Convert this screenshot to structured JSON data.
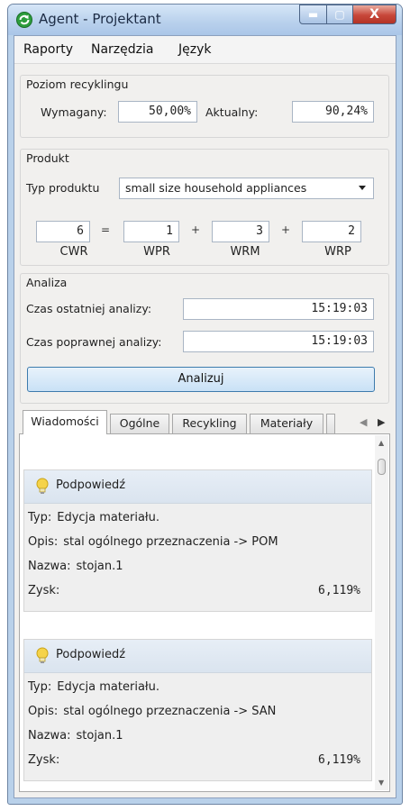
{
  "window": {
    "title": "Agent - Projektant",
    "min_glyph": "▬",
    "max_glyph": "▢",
    "close_glyph": "X"
  },
  "menu": {
    "items": [
      "Raporty",
      "Narzędzia",
      "Język"
    ]
  },
  "recycling": {
    "group_label": "Poziom recyklingu",
    "required_label": "Wymagany:",
    "required_value": "50,00%",
    "actual_label": "Aktualny:",
    "actual_value": "90,24%"
  },
  "product": {
    "group_label": "Produkt",
    "type_label": "Typ produktu",
    "type_value": "small size household appliances",
    "eq": "=",
    "plus": "+",
    "cwr": {
      "value": "6",
      "label": "CWR"
    },
    "wpr": {
      "value": "1",
      "label": "WPR"
    },
    "wrm": {
      "value": "3",
      "label": "WRM"
    },
    "wrp": {
      "value": "2",
      "label": "WRP"
    }
  },
  "analysis": {
    "group_label": "Analiza",
    "last_label": "Czas ostatniej analizy:",
    "last_value": "15:19:03",
    "valid_label": "Czas poprawnej analizy:",
    "valid_value": "15:19:03",
    "button_label": "Analizuj"
  },
  "tabs": {
    "items": [
      "Wiadomości",
      "Ogólne",
      "Recykling",
      "Materiały"
    ]
  },
  "messages": [
    {
      "title": "Podpowiedź",
      "type_key": "Typ:",
      "type": "Edycja materiału.",
      "desc_key": "Opis:",
      "desc": "stal ogólnego przeznaczenia -> POM",
      "name_key": "Nazwa:",
      "name": "stojan.1",
      "gain_key": "Zysk:",
      "gain": "6,119%"
    },
    {
      "title": "Podpowiedź",
      "type_key": "Typ:",
      "type": "Edycja materiału.",
      "desc_key": "Opis:",
      "desc": "stal ogólnego przeznaczenia -> SAN",
      "name_key": "Nazwa:",
      "name": "stojan.1",
      "gain_key": "Zysk:",
      "gain": "6,119%"
    }
  ],
  "colors": {
    "accent": "#3d7bad",
    "title_bar": "#b8d0ec",
    "hint_bulb": "#f5d34a"
  }
}
